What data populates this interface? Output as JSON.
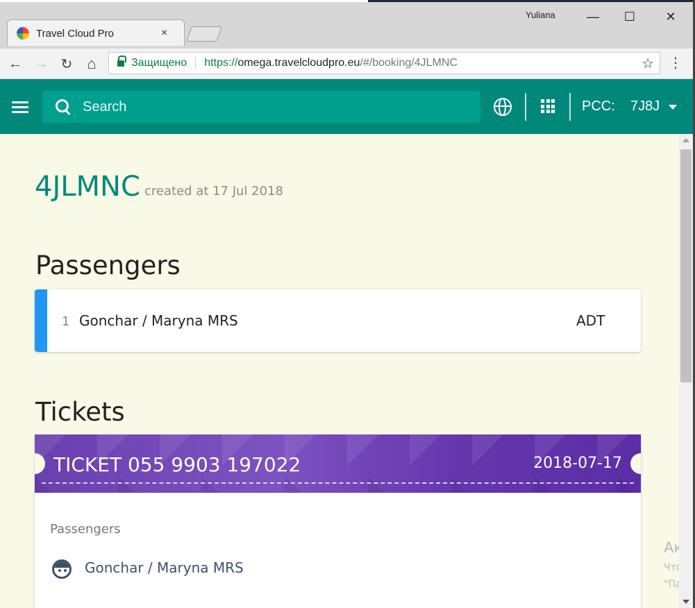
{
  "window": {
    "user": "Yuliana",
    "minimize": "—",
    "maximize": "☐",
    "close": "✕"
  },
  "browser": {
    "tab_title": "Travel Cloud Pro",
    "tab_close": "×",
    "secure_label": "Защищено",
    "url_scheme": "https://",
    "url_host": "omega.travelcloudpro.eu",
    "url_path": "/#/booking/4JLMNC",
    "back": "←",
    "forward": "→",
    "reload": "↻",
    "home": "⌂",
    "star": "☆",
    "menu": "⋮"
  },
  "appbar": {
    "search_placeholder": "Search",
    "pcc_label": "PCC:",
    "pcc_value": "7J8J"
  },
  "booking": {
    "pnr": "4JLMNC",
    "created": "created at 17 Jul 2018"
  },
  "passengers": {
    "title": "Passengers",
    "items": [
      {
        "index": "1",
        "name": "Gonchar / Maryna MRS",
        "type": "ADT"
      }
    ]
  },
  "tickets": {
    "title": "Tickets",
    "items": [
      {
        "title": "TICKET  055 9903 197022",
        "date": "2018-07-17",
        "passengers_label": "Passengers",
        "passenger_name": "Gonchar / Maryna MRS"
      }
    ]
  },
  "watermark": {
    "line1": "Акти",
    "line2": "Чтоб",
    "line3": "\"Пара"
  },
  "colors": {
    "appbar": "#00897b",
    "content_bg": "#f8f9e7",
    "accent_blue": "#2196f3",
    "ticket_purple": "#6a3fb0"
  }
}
